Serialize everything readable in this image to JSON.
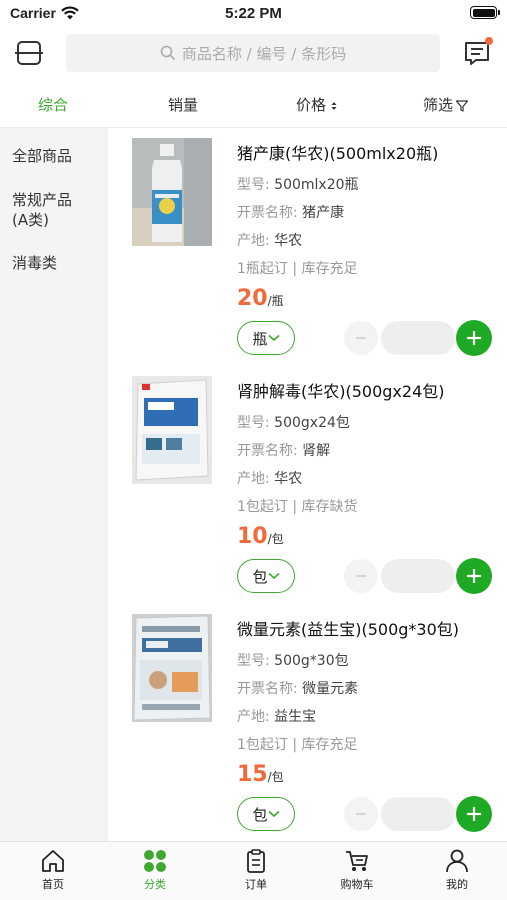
{
  "status_bar": {
    "carrier": "Carrier",
    "time": "5:22 PM"
  },
  "header": {
    "search_placeholder": "商品名称 / 编号 / 条形码"
  },
  "sort_bar": {
    "items": [
      "综合",
      "销量",
      "价格",
      "筛选"
    ],
    "active": "综合"
  },
  "categories": [
    "全部商品",
    "常规产品\n(A类)",
    "消毒类"
  ],
  "labels": {
    "model": "型号:",
    "invoice_name": "开票名称:",
    "origin": "产地:"
  },
  "products": [
    {
      "name": "猪产康(华农)(500mlx20瓶)",
      "model": "500mlx20瓶",
      "invoice_name": "猪产康",
      "origin": "华农",
      "order_info": "1瓶起订 | 库存充足",
      "price": "20",
      "unit": "/瓶",
      "unit_button": "瓶"
    },
    {
      "name": "肾肿解毒(华农)(500gx24包)",
      "model": "500gx24包",
      "invoice_name": "肾解",
      "origin": "华农",
      "order_info": "1包起订 | 库存缺货",
      "price": "10",
      "unit": "/包",
      "unit_button": "包"
    },
    {
      "name": "微量元素(益生宝)(500g*30包)",
      "model": "500g*30包",
      "invoice_name": "微量元素",
      "origin": "益生宝",
      "order_info": "1包起订 | 库存充足",
      "price": "15",
      "unit": "/包",
      "unit_button": "包"
    }
  ],
  "tab_bar": {
    "items": [
      "首页",
      "分类",
      "订单",
      "购物车",
      "我的"
    ],
    "active": "分类"
  },
  "colors": {
    "accent": "#3daa2e",
    "price": "#f26a3b",
    "plus_button": "#1faa26",
    "badge": "#f06a3a"
  },
  "icons": [
    "scan-icon",
    "search-icon",
    "message-icon",
    "home-icon",
    "category-icon",
    "order-icon",
    "cart-icon",
    "profile-icon",
    "chevron-down-icon",
    "plus-icon",
    "minus-icon"
  ]
}
